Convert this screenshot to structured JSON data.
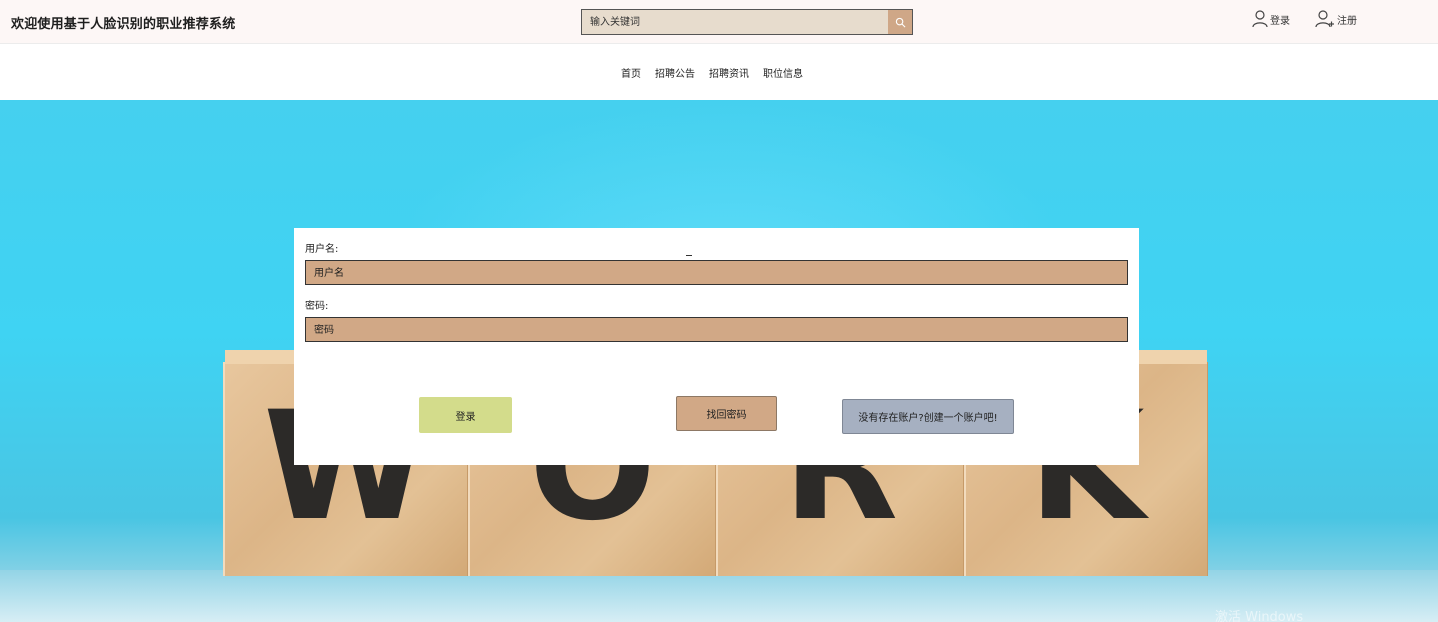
{
  "header": {
    "title": "欢迎使用基于人脸识别的职业推荐系统",
    "search_placeholder": "输入关键词",
    "login_label": "登录",
    "register_label": "注册"
  },
  "nav": {
    "items": [
      "首页",
      "招聘公告",
      "招聘资讯",
      "职位信息"
    ]
  },
  "hero": {
    "letters": [
      "W",
      "O",
      "R",
      "K"
    ],
    "watermark": "激活 Windows"
  },
  "form": {
    "username_label": "用户名:",
    "username_placeholder": "用户名",
    "password_label": "密码:",
    "password_placeholder": "密码",
    "login_button": "登录",
    "forgot_button": "找回密码",
    "register_button": "没有存在账户?创建一个账户吧!"
  },
  "colors": {
    "input_bg": "#d1a886",
    "login_btn": "#d3dc8b",
    "register_btn": "#a6b0c1",
    "hero_bg": "#3fd3f3"
  }
}
